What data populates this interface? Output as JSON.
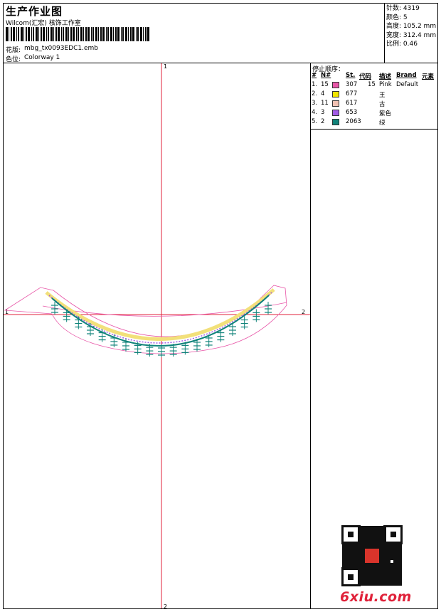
{
  "header": {
    "title": "生产作业图",
    "company": "Wilcom(汇宏) 核饰工作室",
    "design_label": "花版:",
    "design_value": "mbg_tx0093EDC1.emb",
    "colorway_label": "色位:",
    "colorway_value": "Colorway 1"
  },
  "stats": {
    "stitches_label": "针数:",
    "stitches": "4319",
    "colors_label": "颜色:",
    "colors": "5",
    "height_label": "高度:",
    "height": "105.2 mm",
    "width_label": "宽度:",
    "width": "312.4 mm",
    "scale_label": "比例:",
    "scale": "0.46"
  },
  "stop_sequence": {
    "title": "停止顺序：",
    "headers": [
      "#",
      "N#",
      "St.",
      "代码",
      "描述",
      "Brand",
      "元素"
    ],
    "rows": [
      {
        "idx": "1.",
        "n": "15",
        "color": "#e857a8",
        "code": "307",
        "st": "15",
        "desc": "Pink",
        "brand": "Default"
      },
      {
        "idx": "2.",
        "n": "4",
        "color": "#f2e600",
        "code": "677",
        "st": "",
        "desc": "王",
        "brand": ""
      },
      {
        "idx": "3.",
        "n": "11",
        "color": "#f1c1b2",
        "code": "617",
        "st": "",
        "desc": "古",
        "brand": ""
      },
      {
        "idx": "4.",
        "n": "3",
        "color": "#a25be6",
        "code": "653",
        "st": "",
        "desc": "紫色",
        "brand": ""
      },
      {
        "idx": "5.",
        "n": "2",
        "color": "#10837a",
        "code": "2063",
        "st": "",
        "desc": "绿",
        "brand": ""
      }
    ]
  },
  "axes": {
    "top_label": "1",
    "bottom_label": "2",
    "left_label": "1",
    "right_label": "2",
    "axis_color": "#e0223a"
  },
  "design_colors": {
    "outline": "#e857a8",
    "fill": "#f2e07a",
    "accent": "#a25be6",
    "stitch": "#10837a"
  },
  "watermark": {
    "site": "6xiu.com"
  }
}
